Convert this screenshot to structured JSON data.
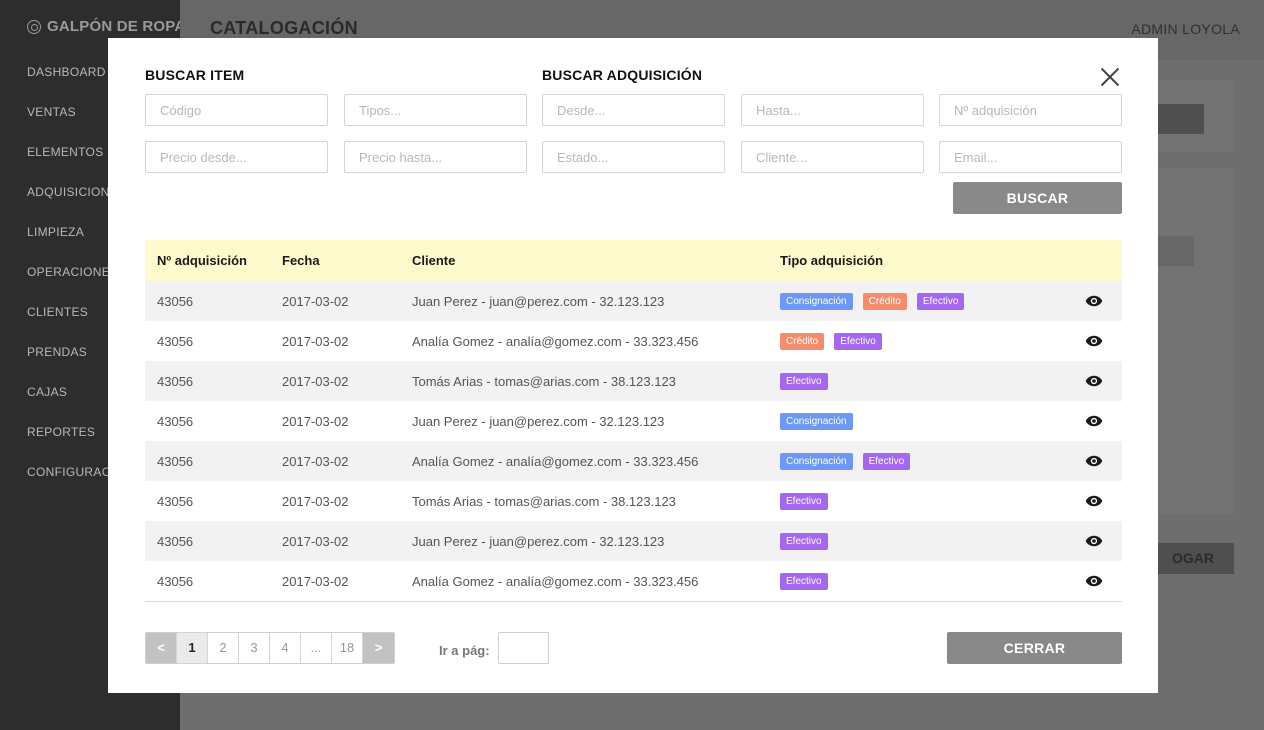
{
  "app": {
    "brand": "GALPÓN DE ROPA",
    "page_title": "CATALOGACIÓN",
    "user": "ADMIN LOYOLA",
    "background_button_label": "OGAR"
  },
  "sidebar": {
    "items": [
      {
        "label": "DASHBOARD"
      },
      {
        "label": "VENTAS"
      },
      {
        "label": "ELEMENTOS"
      },
      {
        "label": "ADQUISICIONES"
      },
      {
        "label": "LIMPIEZA"
      },
      {
        "label": "OPERACIONES"
      },
      {
        "label": "CLIENTES"
      },
      {
        "label": "PRENDAS"
      },
      {
        "label": "CAJAS"
      },
      {
        "label": "REPORTES"
      },
      {
        "label": "CONFIGURACIÓN"
      }
    ]
  },
  "modal": {
    "buscar_item_title": "BUSCAR ITEM",
    "buscar_adquisicion_title": "BUSCAR ADQUISICIÓN",
    "fields": {
      "codigo": "Código",
      "tipos": "Tipos...",
      "desde": "Desde...",
      "hasta": "Hasta...",
      "num_adquisicion": "Nº adquisición",
      "precio_desde": "Precio desde...",
      "precio_hasta": "Precio hasta...",
      "estado": "Estado...",
      "cliente": "Cliente...",
      "email": "Email..."
    },
    "buscar_label": "BUSCAR",
    "cerrar_label": "CERRAR",
    "goto_label": "Ir a pág:",
    "goto_value": ""
  },
  "table": {
    "headers": {
      "num": "Nº adquisición",
      "fecha": "Fecha",
      "cliente": "Cliente",
      "tipo": "Tipo adquisición"
    },
    "rows": [
      {
        "num": "43056",
        "fecha": "2017-03-02",
        "cliente": "Juan Perez -  juan@perez.com - 32.123.123",
        "tipos": [
          "Consignación",
          "Crédito",
          "Efectivo"
        ]
      },
      {
        "num": "43056",
        "fecha": "2017-03-02",
        "cliente": "Analía Gomez - analía@gomez.com - 33.323.456",
        "tipos": [
          "Crédito",
          "Efectivo"
        ]
      },
      {
        "num": "43056",
        "fecha": "2017-03-02",
        "cliente": "Tomás Arias - tomas@arias.com - 38.123.123",
        "tipos": [
          "Efectivo"
        ]
      },
      {
        "num": "43056",
        "fecha": "2017-03-02",
        "cliente": "Juan Perez -  juan@perez.com - 32.123.123",
        "tipos": [
          "Consignación"
        ]
      },
      {
        "num": "43056",
        "fecha": "2017-03-02",
        "cliente": "Analía Gomez - analía@gomez.com - 33.323.456",
        "tipos": [
          "Consignación",
          "Efectivo"
        ]
      },
      {
        "num": "43056",
        "fecha": "2017-03-02",
        "cliente": "Tomás Arias - tomas@arias.com - 38.123.123",
        "tipos": [
          "Efectivo"
        ]
      },
      {
        "num": "43056",
        "fecha": "2017-03-02",
        "cliente": "Juan Perez -  juan@perez.com - 32.123.123",
        "tipos": [
          "Efectivo"
        ]
      },
      {
        "num": "43056",
        "fecha": "2017-03-02",
        "cliente": "Analía Gomez - analía@gomez.com - 33.323.456",
        "tipos": [
          "Efectivo"
        ]
      }
    ],
    "badge_colors": {
      "Consignación": "#6e98f5",
      "Crédito": "#f58d6c",
      "Efectivo": "#a468f0"
    },
    "row_icon": "eye-icon"
  },
  "pagination": {
    "prev": "<",
    "next": ">",
    "pages": [
      "1",
      "2",
      "3",
      "4",
      "...",
      "18"
    ],
    "current": "1"
  }
}
